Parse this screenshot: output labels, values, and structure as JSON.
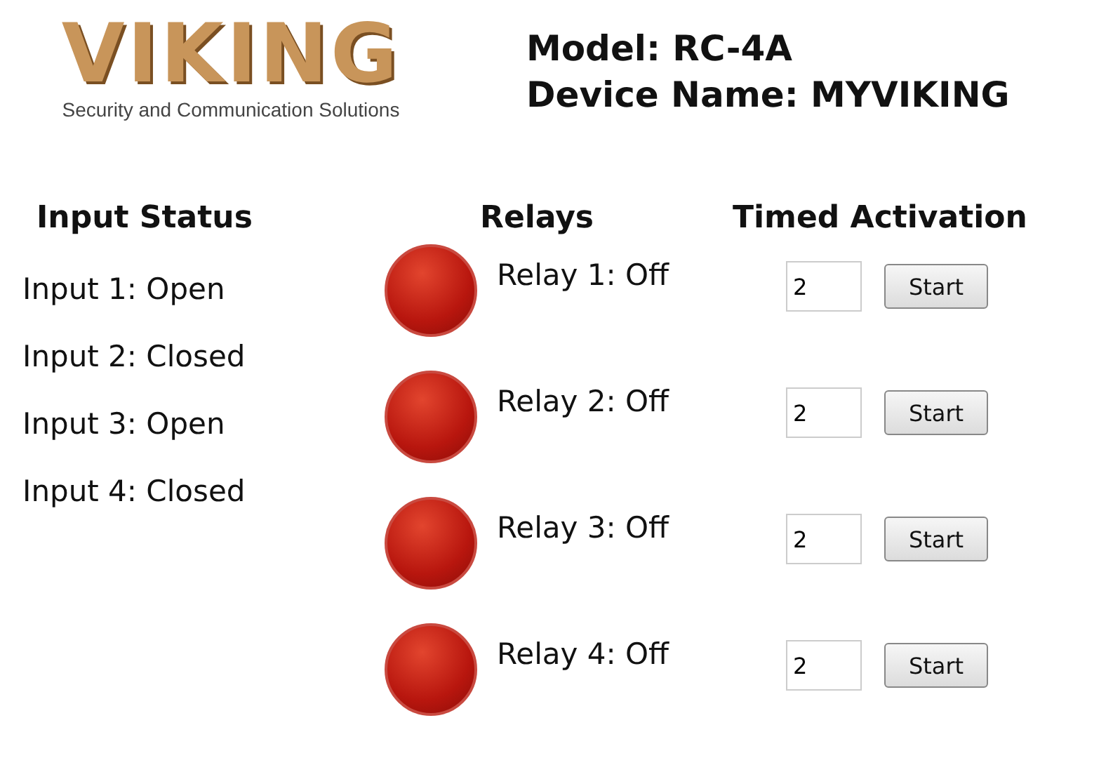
{
  "logo": {
    "name": "VIKING",
    "tagline": "Security and Communication Solutions"
  },
  "header": {
    "model": "Model: RC-4A",
    "device_name": "Device Name: MYVIKING"
  },
  "inputs": {
    "title": "Input Status",
    "items": [
      "Input 1: Open",
      "Input 2: Closed",
      "Input 3: Open",
      "Input 4: Closed"
    ]
  },
  "relays": {
    "title": "Relays",
    "items": [
      {
        "label": "Relay 1: Off",
        "on": false
      },
      {
        "label": "Relay 2: Off",
        "on": false
      },
      {
        "label": "Relay 3: Off",
        "on": false
      },
      {
        "label": "Relay 4: Off",
        "on": false
      }
    ]
  },
  "timed_activation": {
    "title": "Timed Activation",
    "rows": [
      {
        "value": "2",
        "button": "Start"
      },
      {
        "value": "2",
        "button": "Start"
      },
      {
        "value": "2",
        "button": "Start"
      },
      {
        "value": "2",
        "button": "Start"
      }
    ]
  }
}
